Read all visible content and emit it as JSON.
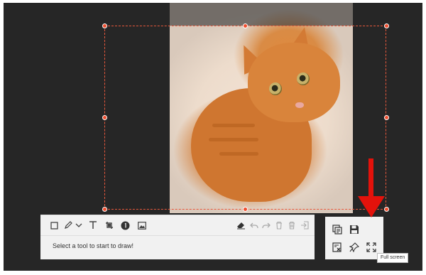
{
  "editor": {
    "hint_text": "Select a tool to start to draw!",
    "tooltip_text": "Full screen",
    "accent_color": "#e3120b",
    "selection_color": "#e8583c"
  },
  "toolbar": {
    "tools": [
      {
        "name": "rectangle-tool",
        "icon": "rectangle-icon"
      },
      {
        "name": "pen-tool",
        "icon": "pen-icon"
      },
      {
        "name": "pen-options",
        "icon": "chevron-down-icon"
      },
      {
        "name": "text-tool",
        "icon": "text-icon"
      },
      {
        "name": "crop-tool",
        "icon": "crop-icon"
      },
      {
        "name": "number-tool",
        "icon": "numbered-marker-icon"
      },
      {
        "name": "image-tool",
        "icon": "image-icon"
      }
    ],
    "actions": [
      {
        "name": "eraser-button",
        "icon": "eraser-icon"
      },
      {
        "name": "undo-button",
        "icon": "undo-icon"
      },
      {
        "name": "redo-button",
        "icon": "redo-icon"
      },
      {
        "name": "delete-button",
        "icon": "trash-icon"
      },
      {
        "name": "clear-button",
        "icon": "trash-all-icon"
      },
      {
        "name": "exit-button",
        "icon": "exit-icon"
      }
    ]
  },
  "side_panel": {
    "buttons": [
      {
        "name": "copy-button",
        "icon": "copy-icon"
      },
      {
        "name": "save-button",
        "icon": "floppy-icon"
      },
      {
        "name": "close-image-button",
        "icon": "close-image-icon"
      },
      {
        "name": "pin-button",
        "icon": "pin-icon"
      },
      {
        "name": "fullscreen-button",
        "icon": "fullscreen-icon"
      }
    ]
  }
}
